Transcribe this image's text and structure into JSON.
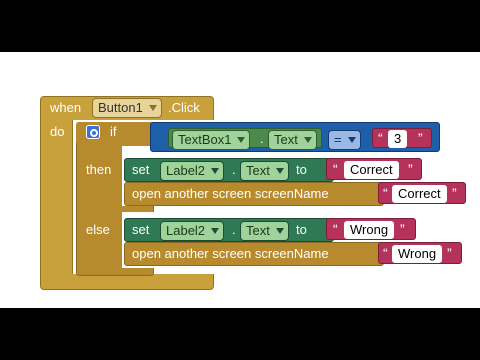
{
  "when_block": {
    "when_label": "when",
    "component": "Button1",
    "event": ".Click",
    "do_label": "do"
  },
  "if_block": {
    "if_label": "if",
    "then_label": "then",
    "else_label": "else"
  },
  "condition": {
    "component": "TextBox1",
    "dot": ".",
    "property": "Text",
    "operator": "=",
    "value": "3"
  },
  "then_branch": {
    "set_label": "set",
    "component": "Label2",
    "dot": ".",
    "property": "Text",
    "to_label": "to",
    "value": "Correct",
    "open_label": "open another screen  screenName",
    "screen_name": "Correct"
  },
  "else_branch": {
    "set_label": "set",
    "component": "Label2",
    "dot": ".",
    "property": "Text",
    "to_label": "to",
    "value": "Wrong",
    "open_label": "open another screen  screenName",
    "screen_name": "Wrong"
  },
  "colors": {
    "event": "#c5a13e",
    "event_dark": "#8f7323",
    "control": "#b78b2d",
    "text_component": "#4a8b4c",
    "setter": "#2f7a55",
    "string": "#b5325a",
    "compare": "#3367b3",
    "compare_outer": "#1e5fa8"
  }
}
